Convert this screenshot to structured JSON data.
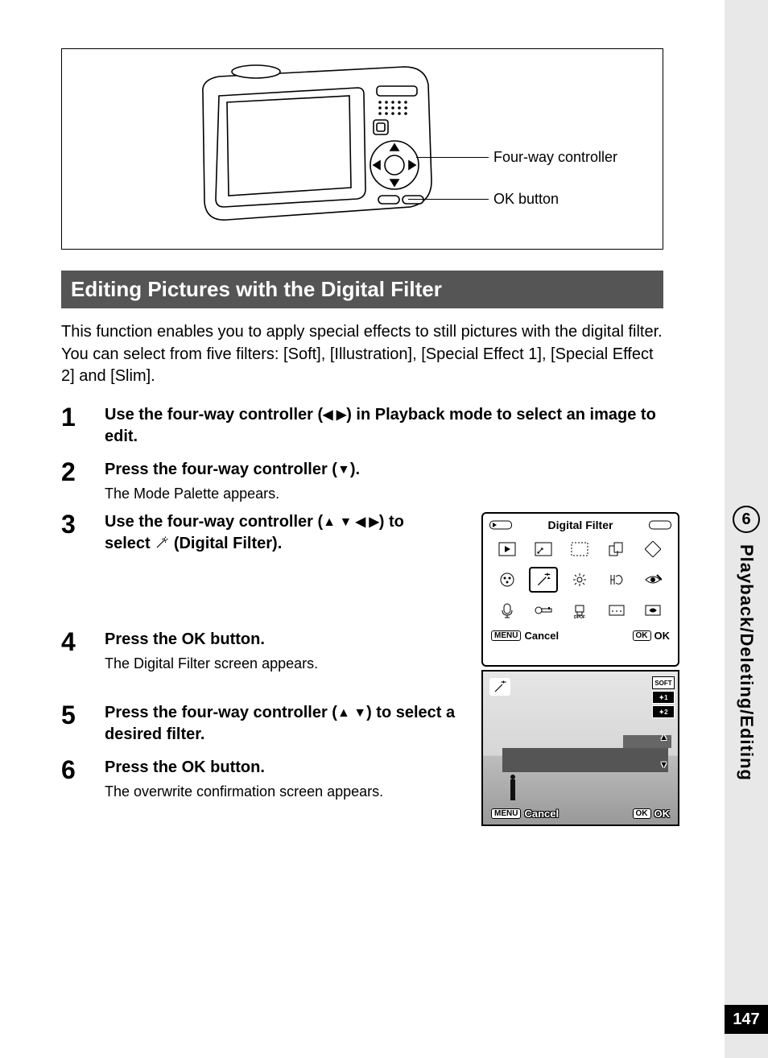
{
  "diagram": {
    "callouts": [
      "Four-way controller",
      "OK button"
    ]
  },
  "section_title": "Editing Pictures with the Digital Filter",
  "intro": "This function enables you to apply special effects to still pictures with the digital filter. You can select from five filters: [Soft], [Illustration], [Special Effect 1], [Special Effect 2] and [Slim].",
  "steps": [
    {
      "num": "1",
      "title_pre": "Use the four-way controller (",
      "title_arrows": "◀ ▶",
      "title_post": ") in Playback mode to select an image to edit.",
      "desc": ""
    },
    {
      "num": "2",
      "title_pre": "Press the four-way controller (",
      "title_arrows": "▼",
      "title_post": ").",
      "desc": "The Mode Palette appears."
    },
    {
      "num": "3",
      "title_pre": "Use the four-way controller (",
      "title_arrows": "▲ ▼ ◀ ▶",
      "title_post": ") to select ",
      "title_tail": " (Digital Filter).",
      "desc": "",
      "has_icon": true
    },
    {
      "num": "4",
      "title_pre": "Press the OK button.",
      "title_arrows": "",
      "title_post": "",
      "desc": "The Digital Filter screen appears."
    },
    {
      "num": "5",
      "title_pre": "Press the four-way controller (",
      "title_arrows": "▲ ▼",
      "title_post": ") to select a desired filter.",
      "desc": ""
    },
    {
      "num": "6",
      "title_pre": "Press the OK button.",
      "title_arrows": "",
      "title_post": "",
      "desc": "The overwrite confirmation screen appears."
    }
  ],
  "palette_screen": {
    "title": "Digital Filter",
    "menu_label": "MENU",
    "cancel": "Cancel",
    "ok_chip": "OK",
    "ok": "OK"
  },
  "filter_screen": {
    "filters": [
      "SOFT",
      "✦1",
      "✦2"
    ],
    "menu_label": "MENU",
    "cancel": "Cancel",
    "ok_chip": "OK",
    "ok": "OK"
  },
  "side": {
    "chapter_num": "6",
    "chapter_title": "Playback/Deleting/Editing",
    "page_num": "147"
  }
}
